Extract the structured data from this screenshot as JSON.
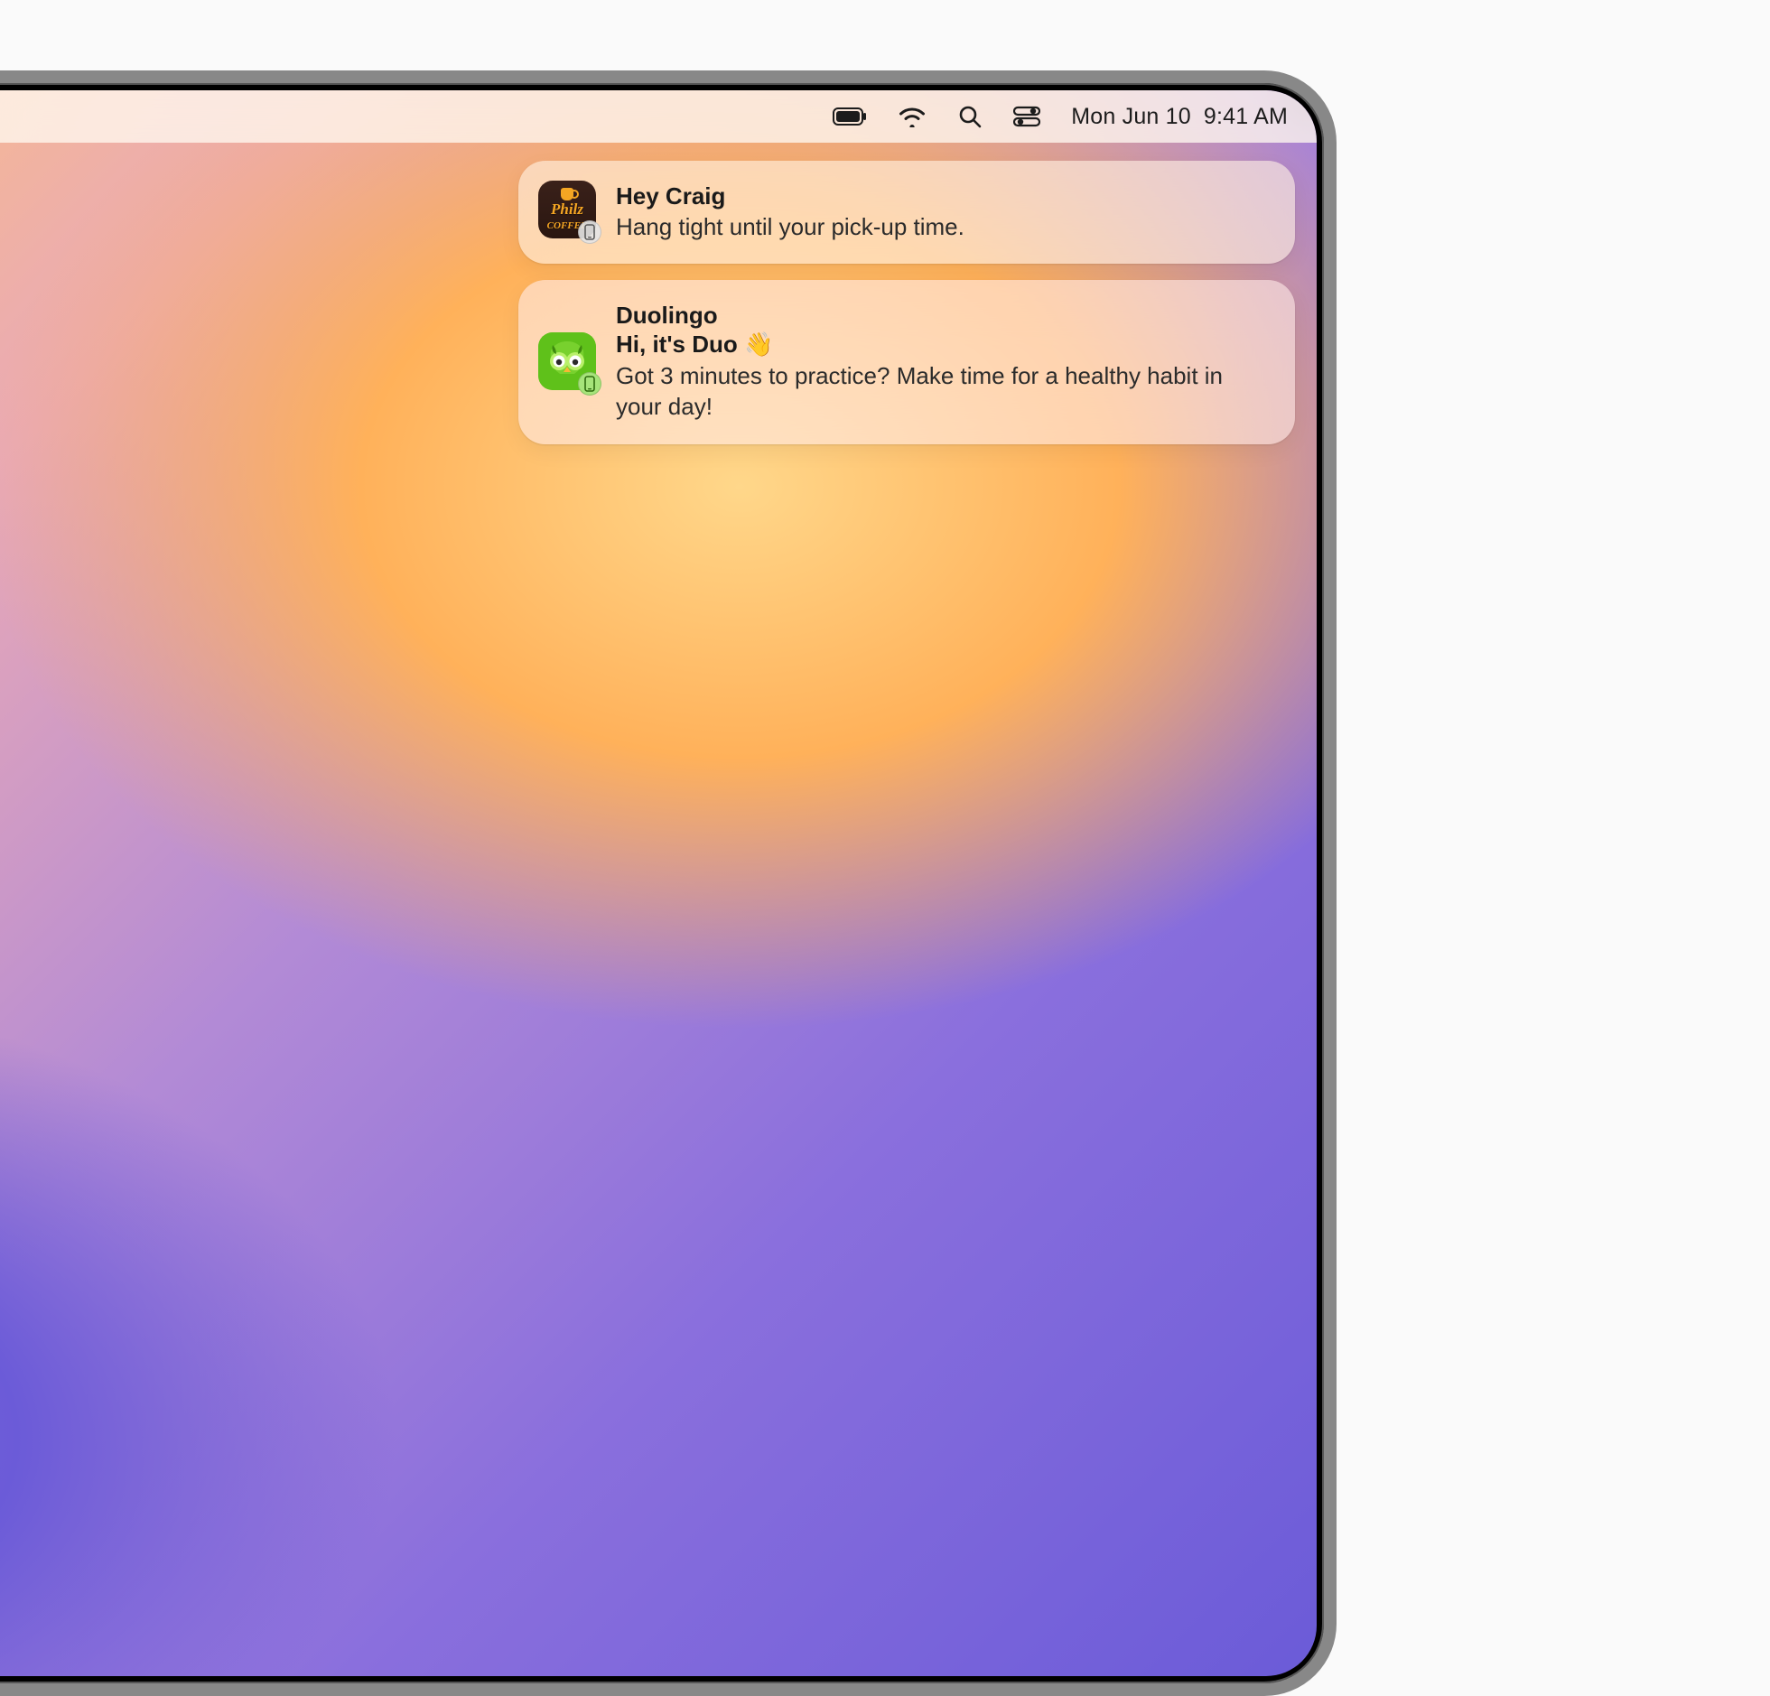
{
  "menubar": {
    "date": "Mon Jun 10",
    "time": "9:41 AM"
  },
  "notifications": [
    {
      "app_icon_name": "philz-coffee-icon",
      "app_icon_label": "Philz Coffee",
      "title": "Hey Craig",
      "subtitle": "",
      "message": "Hang tight until your pick-up time."
    },
    {
      "app_icon_name": "duolingo-icon",
      "app_icon_label": "Duolingo",
      "title": "Duolingo",
      "subtitle": "Hi, it's Duo 👋",
      "message": "Got 3 minutes to practice? Make time for a healthy habit in your day!"
    }
  ]
}
